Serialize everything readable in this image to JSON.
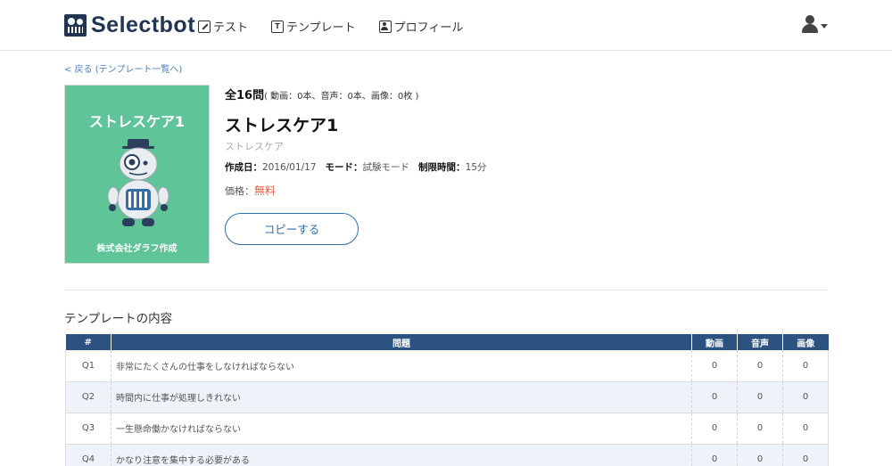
{
  "header": {
    "logo_text": "Selectbot",
    "nav": [
      {
        "label": "テスト",
        "icon": "pencil-square-icon"
      },
      {
        "label": "テンプレート",
        "icon": "template-icon"
      },
      {
        "label": "プロフィール",
        "icon": "profile-card-icon"
      }
    ],
    "template_icon_glyph": "T"
  },
  "back_link": "< 戻る (テンプレート一覧へ)",
  "cover": {
    "title": "ストレスケア1",
    "credit": "株式会社ダラフ作成",
    "bg_color": "#5fc497"
  },
  "summary": {
    "count": "全16問",
    "detail": "( 動画：0本、音声：0本、画像：0枚 )"
  },
  "template": {
    "title": "ストレスケア1",
    "subtitle": "ストレスケア",
    "created_label": "作成日：",
    "created_value": "2016/01/17",
    "mode_label": "モード：",
    "mode_value": "試験モード",
    "time_label": "制限時間：",
    "time_value": "15分",
    "price_label": "価格：",
    "price_value": "無料"
  },
  "copy_button": "コピーする",
  "section_title": "テンプレートの内容",
  "table": {
    "headers": [
      "#",
      "問題",
      "動画",
      "音声",
      "画像"
    ],
    "rows": [
      [
        "Q1",
        "非常にたくさんの仕事をしなければならない",
        "0",
        "0",
        "0"
      ],
      [
        "Q2",
        "時間内に仕事が処理しきれない",
        "0",
        "0",
        "0"
      ],
      [
        "Q3",
        "一生懸命働かなければならない",
        "0",
        "0",
        "0"
      ],
      [
        "Q4",
        "かなり注意を集中する必要がある",
        "0",
        "0",
        "0"
      ]
    ]
  },
  "colors": {
    "brand": "#1f3552",
    "accent": "#2f6faa",
    "table_header": "#2c5282",
    "price": "#e8603c"
  }
}
